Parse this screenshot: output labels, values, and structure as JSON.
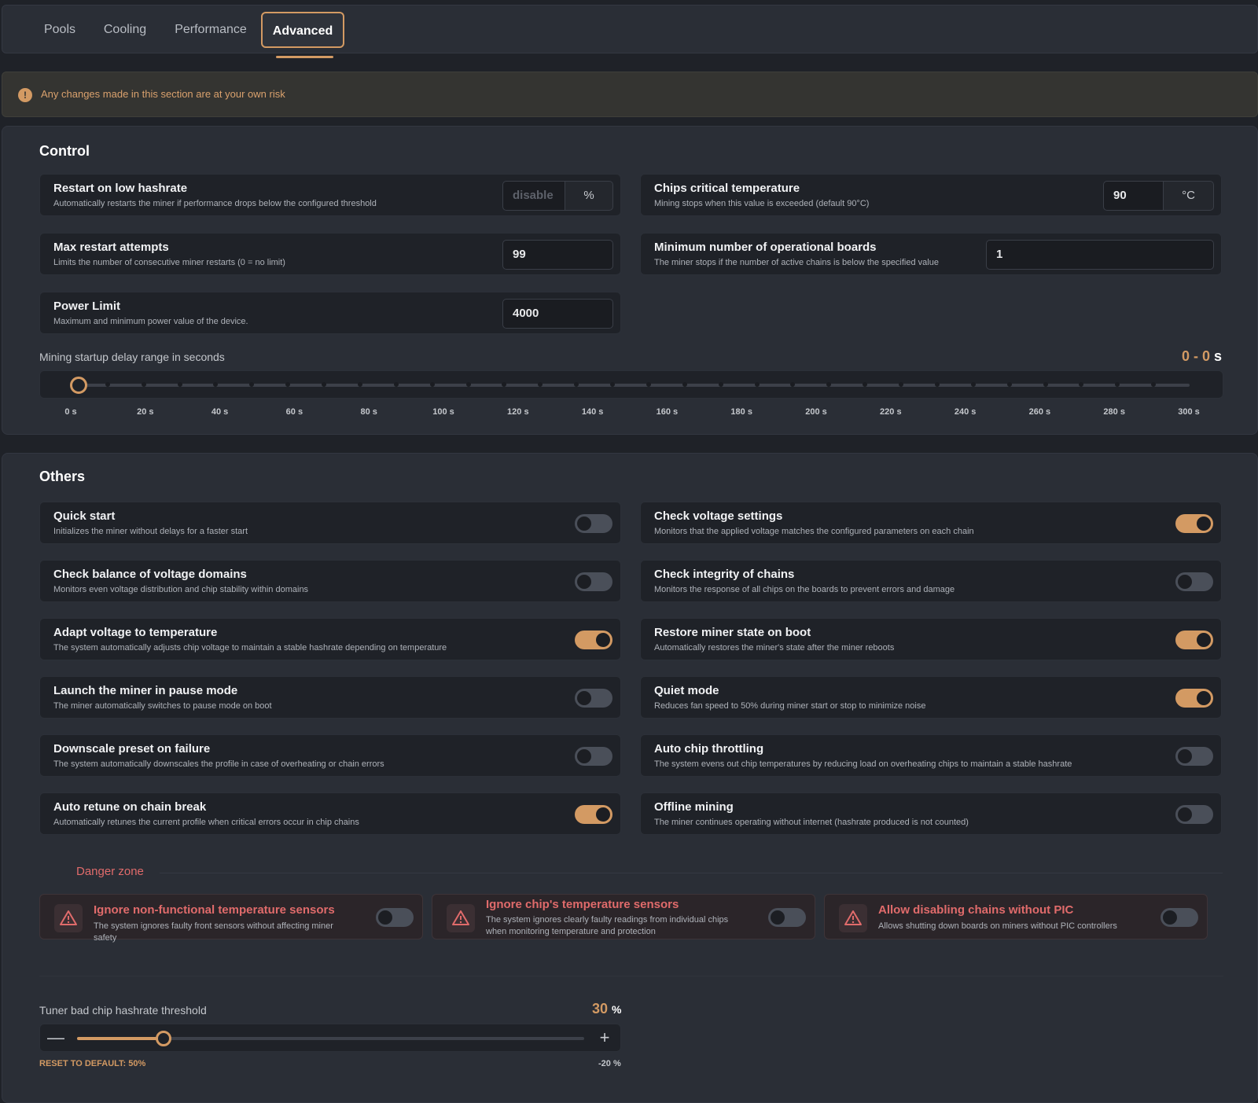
{
  "tabs": [
    {
      "label": "Pools"
    },
    {
      "label": "Cooling"
    },
    {
      "label": "Performance"
    },
    {
      "label": "Advanced",
      "active": true
    }
  ],
  "warning": {
    "icon": "alert-circle-icon",
    "text": "Any changes made in this section are at your own risk"
  },
  "control": {
    "title": "Control",
    "restart_low_hashrate": {
      "title": "Restart on low hashrate",
      "desc": "Automatically restarts the miner if performance drops below the configured threshold",
      "placeholder": "disable",
      "unit": "%"
    },
    "chips_critical_temp": {
      "title": "Chips critical temperature",
      "desc": "Mining stops when this value is exceeded (default 90°C)",
      "value": "90",
      "unit": "°C"
    },
    "max_restart_attempts": {
      "title": "Max restart attempts",
      "desc": "Limits the number of consecutive miner restarts (0 = no limit)",
      "value": "99"
    },
    "min_operational_boards": {
      "title": "Minimum number of operational boards",
      "desc": "The miner stops if the number of active chains is below the specified value",
      "value": "1"
    },
    "power_limit": {
      "title": "Power Limit",
      "desc": "Maximum and minimum power value of the device.",
      "value": "4000"
    },
    "startup_delay": {
      "label": "Mining startup delay range in seconds",
      "value_text": "0 - 0",
      "unit": "s",
      "min": 0,
      "max": 300,
      "low": 0,
      "high": 0,
      "ticks": [
        "0 s",
        "20 s",
        "40 s",
        "60 s",
        "80 s",
        "100 s",
        "120 s",
        "140 s",
        "160 s",
        "180 s",
        "200 s",
        "220 s",
        "240 s",
        "260 s",
        "280 s",
        "300 s"
      ]
    }
  },
  "others": {
    "title": "Others",
    "left": [
      {
        "title": "Quick start",
        "desc": "Initializes the miner without delays for a faster start",
        "on": false
      },
      {
        "title": "Check balance of voltage domains",
        "desc": "Monitors even voltage distribution and chip stability within domains",
        "on": false
      },
      {
        "title": "Adapt voltage to temperature",
        "desc": "The system automatically adjusts chip voltage to maintain a stable hashrate depending on temperature",
        "on": true
      },
      {
        "title": "Launch the miner in pause mode",
        "desc": "The miner automatically switches to pause mode on boot",
        "on": false
      },
      {
        "title": "Downscale preset on failure",
        "desc": "The system automatically downscales the profile in case of overheating or chain errors",
        "on": false
      },
      {
        "title": "Auto retune on chain break",
        "desc": "Automatically retunes the current profile when critical errors occur in chip chains",
        "on": true
      }
    ],
    "right": [
      {
        "title": "Check voltage settings",
        "desc": "Monitors that the applied voltage matches the configured parameters on each chain",
        "on": true
      },
      {
        "title": "Check integrity of chains",
        "desc": "Monitors the response of all chips on the boards to prevent errors and damage",
        "on": false
      },
      {
        "title": "Restore miner state on boot",
        "desc": "Automatically restores the miner's state after the miner reboots",
        "on": true
      },
      {
        "title": "Quiet mode",
        "desc": "Reduces fan speed to 50% during miner start or stop to minimize noise",
        "on": true
      },
      {
        "title": "Auto chip throttling",
        "desc": "The system evens out chip temperatures by reducing load on overheating chips to maintain a stable hashrate",
        "on": false
      },
      {
        "title": "Offline mining",
        "desc": "The miner continues operating without internet (hashrate produced is not counted)",
        "on": false
      }
    ],
    "danger_zone": {
      "title": "Danger zone",
      "items": [
        {
          "title": "Ignore non-functional temperature sensors",
          "desc": "The system ignores faulty front sensors without affecting miner safety",
          "on": false
        },
        {
          "title": "Ignore chip's temperature sensors",
          "desc": "The system ignores clearly faulty readings from individual chips when monitoring temperature and protection",
          "on": false
        },
        {
          "title": "Allow disabling chains without PIC",
          "desc": "Allows shutting down boards on miners without PIC controllers",
          "on": false
        }
      ]
    },
    "tuner": {
      "label": "Tuner bad chip hashrate threshold",
      "value": "30",
      "unit": "%",
      "value_fraction": 0.17,
      "reset_label": "RESET TO DEFAULT: 50%",
      "min_label": "-20 %"
    }
  },
  "colors": {
    "accent": "#d39a63",
    "danger": "#e06b6b",
    "background": "#1f2228",
    "panel": "#2a2e36"
  }
}
